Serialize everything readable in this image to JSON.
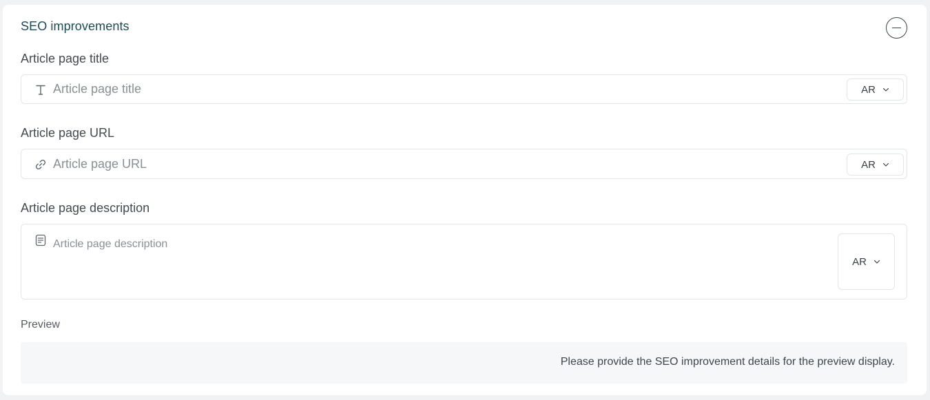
{
  "section": {
    "title": "SEO improvements"
  },
  "fields": {
    "title": {
      "label": "Article page title",
      "placeholder": "Article page title",
      "lang": "AR",
      "icon": "text-icon"
    },
    "url": {
      "label": "Article page URL",
      "placeholder": "Article page URL",
      "lang": "AR",
      "icon": "link-icon"
    },
    "description": {
      "label": "Article page description",
      "placeholder": "Article page description",
      "lang": "AR",
      "icon": "document-icon"
    }
  },
  "preview": {
    "label": "Preview",
    "message": "Please provide the SEO improvement details for the preview display."
  },
  "colors": {
    "title": "#1b4b57",
    "border": "#e3e6e9",
    "preview_bg": "#f6f7f9"
  }
}
